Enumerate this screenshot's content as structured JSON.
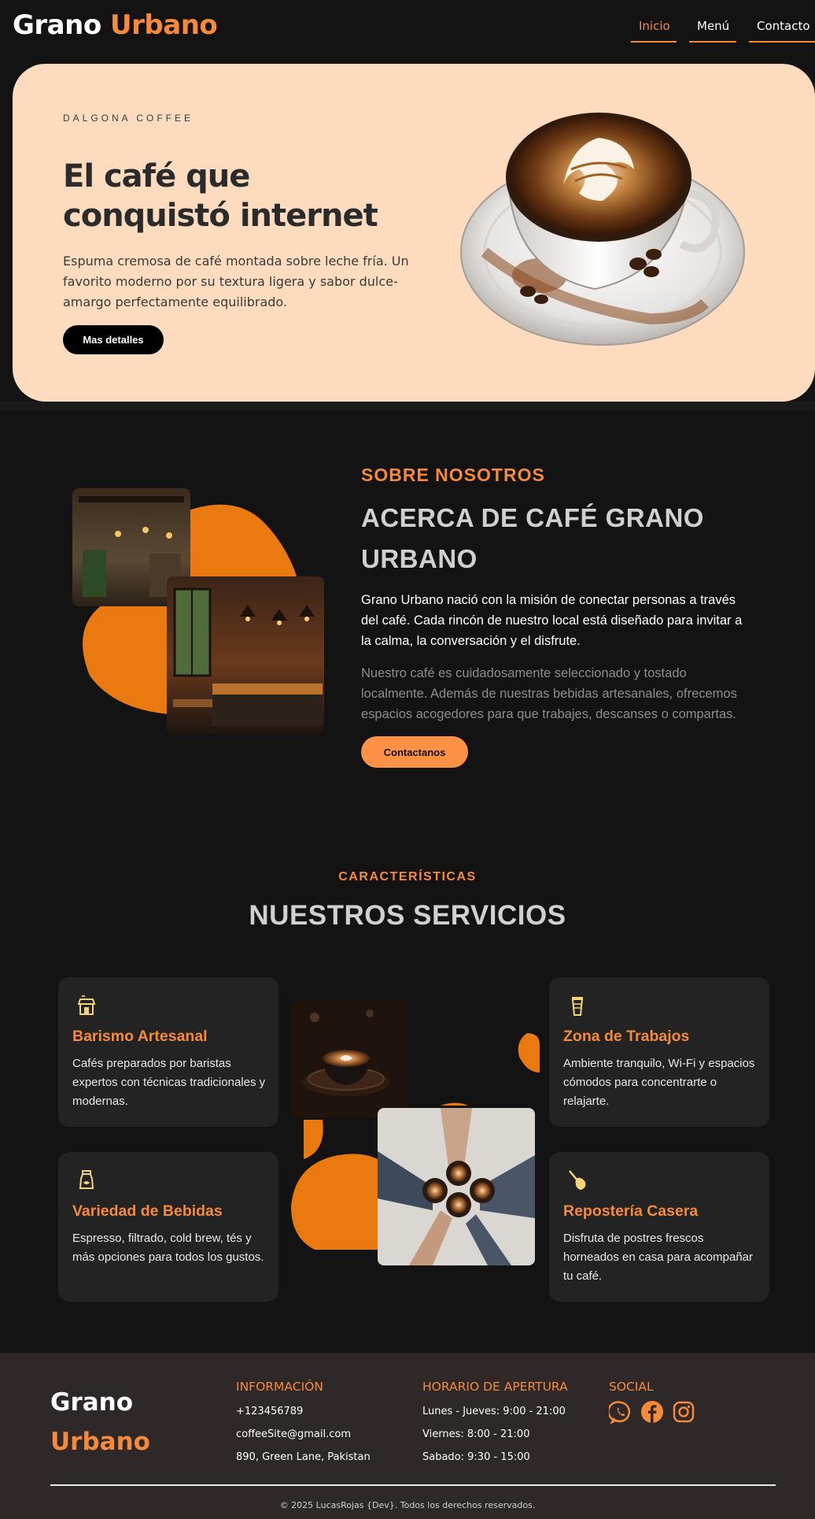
{
  "nav": {
    "logo_part1": "Grano",
    "logo_part2": "Urbano",
    "links": [
      {
        "label": "Inicio",
        "active": true
      },
      {
        "label": "Menú"
      },
      {
        "label": "Contacto"
      }
    ]
  },
  "hero": {
    "eyebrow": "DALGONA COFFEE",
    "title": "El café que conquistó internet",
    "description": "Espuma cremosa de café montada sobre leche fría. Un favorito moderno por su textura ligera y sabor dulce-amargo perfectamente equilibrado.",
    "button_label": "Mas detalles"
  },
  "about": {
    "eyebrow": "SOBRE NOSOTROS",
    "title": "ACERCA DE CAFÉ GRANO URBANO",
    "paragraph1": "Grano Urbano nació con la misión de conectar personas a través del café. Cada rincón de nuestro local está diseñado para invitar a la calma, la conversación y el disfrute.",
    "paragraph2": "Nuestro café es cuidadosamente seleccionado y tostado localmente. Además de nuestras bebidas artesanales, ofrecemos espacios acogedores para que trabajes, descanses o compartas.",
    "button_label": "Contactanos"
  },
  "services": {
    "eyebrow": "CARACTERÍSTICAS",
    "title": "NUESTROS SERVICIOS",
    "cards": [
      {
        "icon": "coffee-shop-icon",
        "title": "Barismo Artesanal",
        "description": "Cafés preparados por baristas expertos con técnicas tradicionales y modernas."
      },
      {
        "icon": "cup-icon",
        "title": "Zona de Trabajos",
        "description": "Ambiente tranquilo, Wi-Fi y espacios cómodos para concentrarte o relajarte."
      },
      {
        "icon": "coffee-pot-icon",
        "title": "Variedad de Bebidas",
        "description": "Espresso, filtrado, cold brew, tés y más opciones para todos los gustos."
      },
      {
        "icon": "whisk-icon",
        "title": "Repostería Casera",
        "description": "Disfruta de postres frescos horneados en casa para acompañar tu café."
      }
    ]
  },
  "footer": {
    "logo_part1": "Grano",
    "logo_part2": "Urbano",
    "info_title": "INFORMACIÓN",
    "phone": "+123456789",
    "email": "coffeeSite@gmail.com",
    "address": "890, Green Lane, Pakistan",
    "hours_title": "HORARIO DE APERTURA",
    "hours": [
      "Lunes - Jueves: 9:00 - 21:00",
      "Viernes: 8:00 - 21:00",
      "Sabado: 9:30 - 15:00"
    ],
    "social_title": "SOCIAL",
    "social_icons": [
      "whatsapp-icon",
      "facebook-icon",
      "instagram-icon"
    ],
    "copyright": "© 2025 LucasRojas {Dev}. Todos los derechos reservados."
  },
  "colors": {
    "accent": "#f58a3b",
    "hero_bg": "#fddbbe",
    "page_bg": "#131313",
    "card_bg": "#232323",
    "footer_bg": "#2e2828"
  }
}
